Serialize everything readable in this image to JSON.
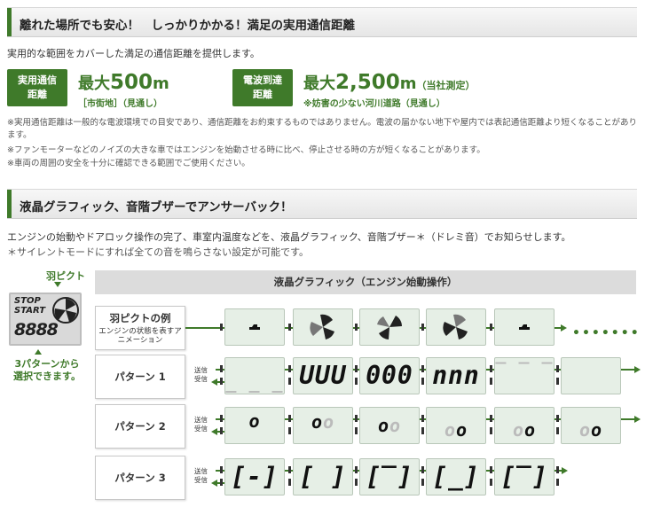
{
  "section1": {
    "title": "離れた場所でも安心！　しっかりかかる！満足の実用通信距離",
    "intro": "実用的な範囲をカバーした満足の通信距離を提供します。",
    "spec1": {
      "badge_line1": "実用通信",
      "badge_line2": "距離",
      "prefix": "最大",
      "value": "500",
      "unit": "m",
      "note": "［市街地］（見通し）"
    },
    "spec2": {
      "badge_line1": "電波到達",
      "badge_line2": "距離",
      "prefix": "最大",
      "value": "2,500",
      "unit": "m",
      "suffix": "（当社測定）",
      "note": "※妨害の少ない河川道路（見通し）"
    },
    "notes": [
      "※実用通信距離は一般的な電波環境での目安であり、通信距離をお約束するものではありません。電波の届かない地下や屋内では表記通信距離より短くなることがあります。",
      "※ファンモーターなどのノイズの大きな車ではエンジンを始動させる時に比べ、停止させる時の方が短くなることがあります。",
      "※車両の周囲の安全を十分に確認できる範囲でご使用ください。"
    ]
  },
  "section2": {
    "title": "液晶グラフィック、音階ブザーでアンサーバック！",
    "intro1": "エンジンの始動やドアロック操作の完了、車室内温度などを、液晶グラフィック、音階ブザー＊（ドレミ音）でお知らせします。",
    "intro2": "＊サイレントモードにすれば全ての音を鳴らさない設定が可能です。"
  },
  "lcd_panel": {
    "label": "羽ピクト",
    "stop": "STOP",
    "start": "START",
    "digits": "8888",
    "note": "3パターンから選択できます。",
    "header": "液晶グラフィック（エンジン始動操作）"
  },
  "rows": [
    {
      "label": "羽ピクトの例",
      "desc": "エンジンの状態を表すアニメーション"
    },
    {
      "label": "パターン 1",
      "send": "送信",
      "recv": "受信"
    },
    {
      "label": "パターン 2",
      "send": "送信",
      "recv": "受信"
    },
    {
      "label": "パターン 3",
      "send": "送信",
      "recv": "受信"
    }
  ],
  "colors": {
    "accent": "#3f7a2a",
    "lcd_bg": "#e6efe6"
  }
}
